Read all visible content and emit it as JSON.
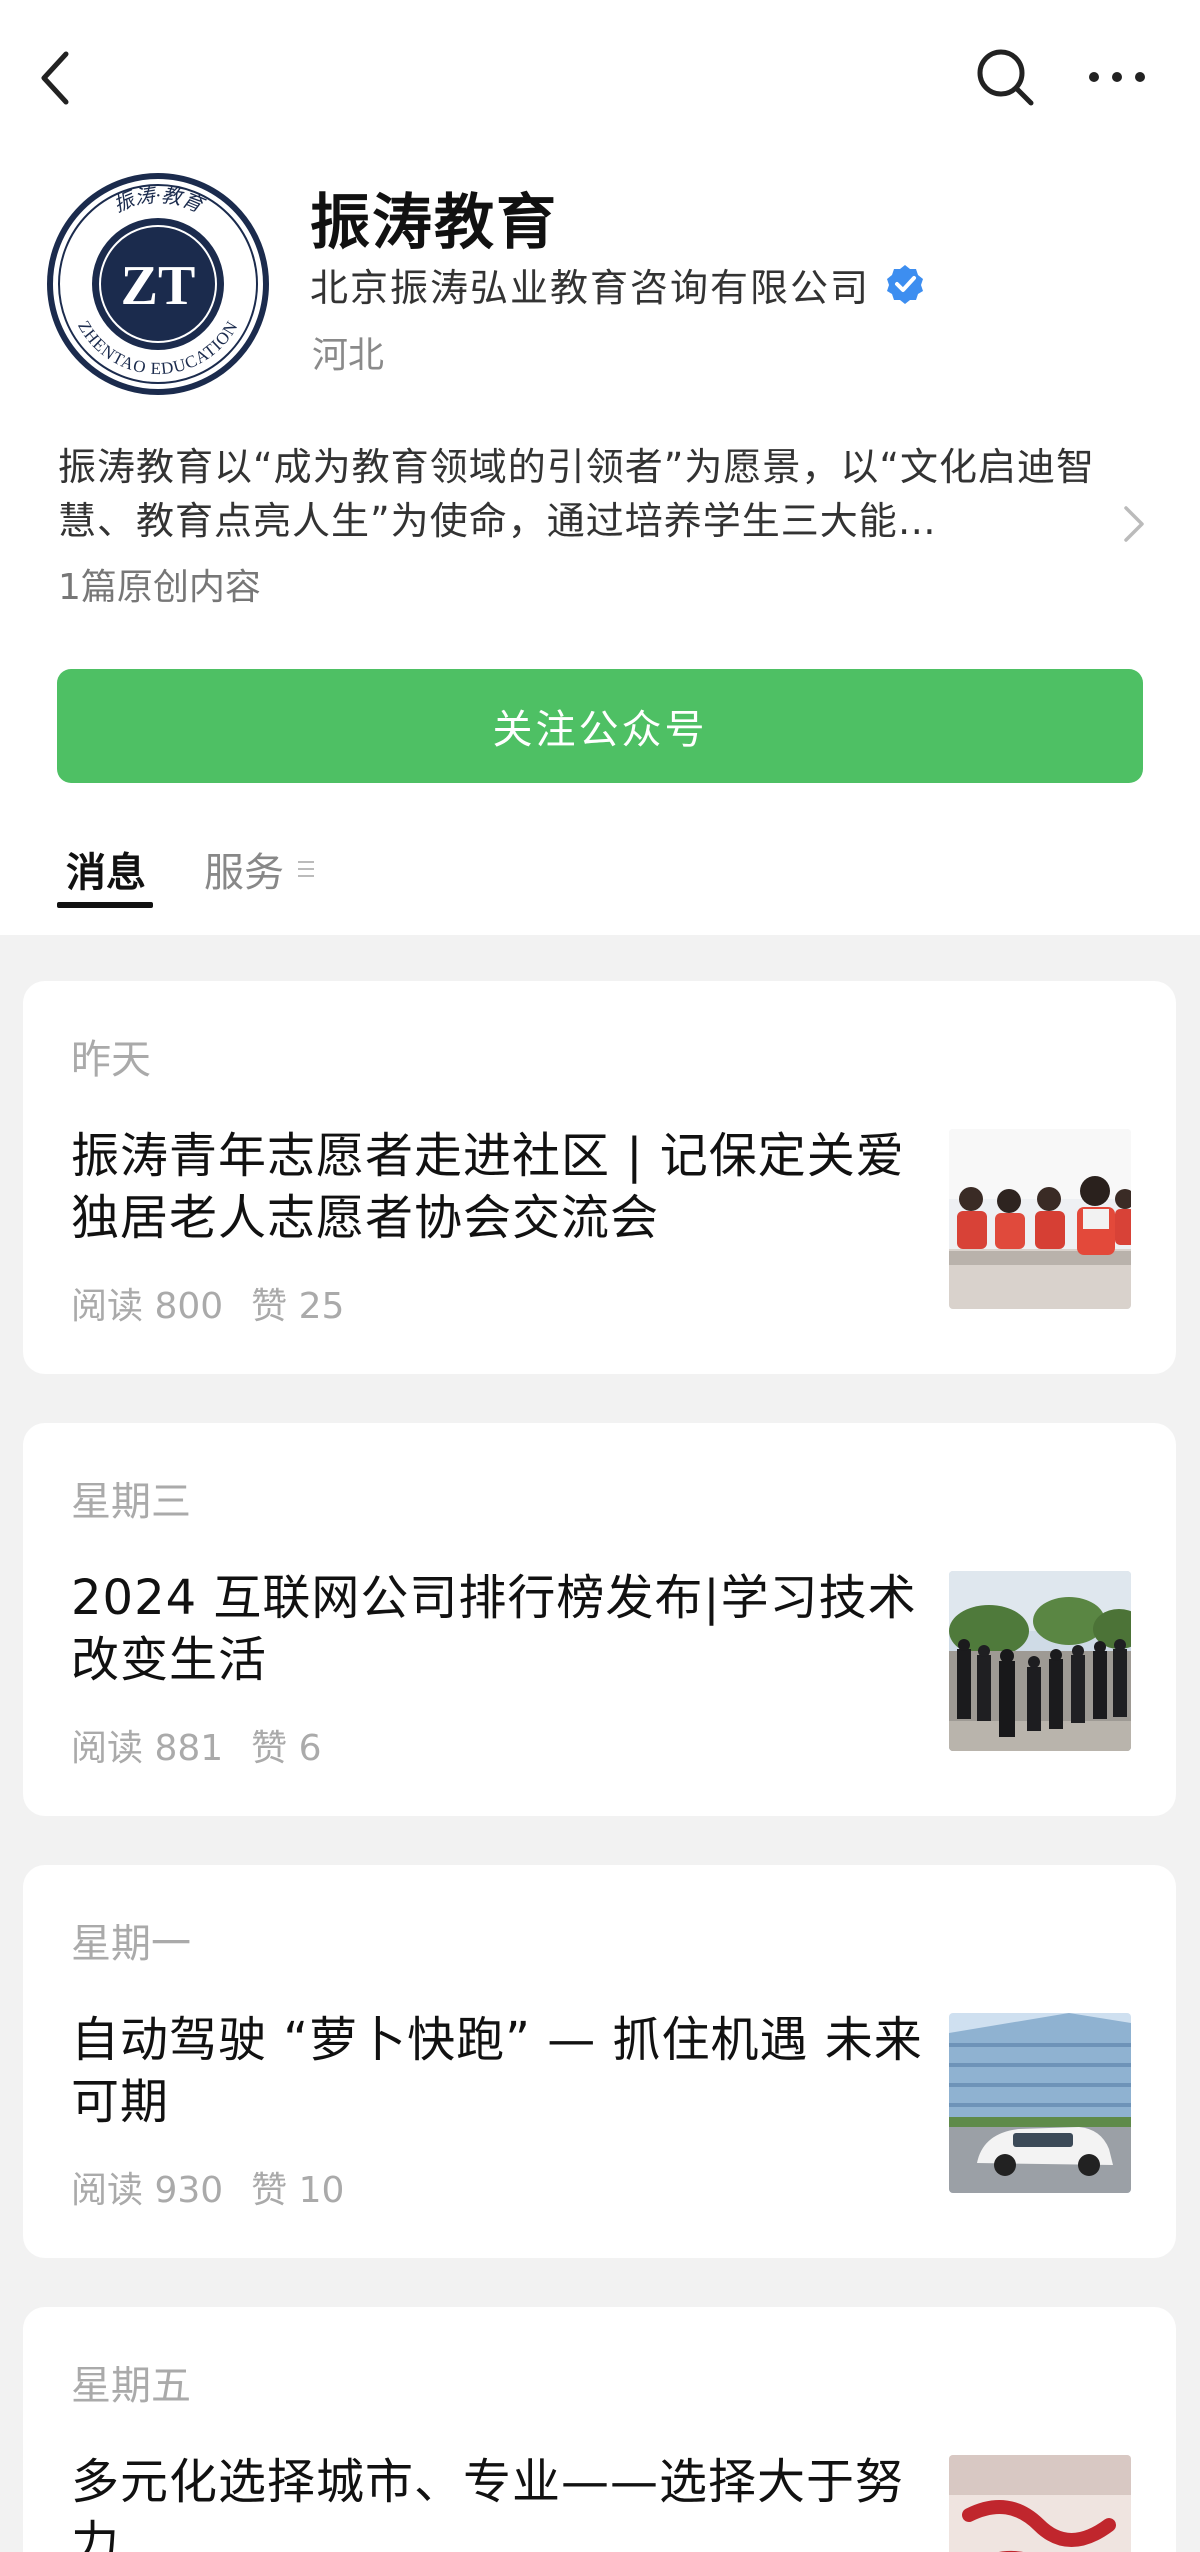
{
  "account": {
    "name": "振涛教育",
    "company": "北京振涛弘业教育咨询有限公司",
    "region": "河北",
    "bio": "振涛教育以“成为教育领域的引领者”为愿景，以“文化启迪智慧、教育点亮人生”为使命，通过培养学生三大能…",
    "originals": "1篇原创内容",
    "follow_label": "关注公众号",
    "logo": {
      "top_text": "振涛·教育",
      "ring_text": "ZHENTAO EDUCATION",
      "mark": "ZT"
    },
    "verified_color": "#3d8ef0"
  },
  "tabs": {
    "messages": "消息",
    "services": "服务"
  },
  "colors": {
    "accent": "#4ec064",
    "brand_navy": "#1b2b4d"
  },
  "articles": [
    {
      "date": "昨天",
      "title": "振涛青年志愿者走进社区 | 记保定关爱独居老人志愿者协会交流会",
      "reads": "阅读 800",
      "likes": "赞 25",
      "thumb": "volunteers-classroom"
    },
    {
      "date": "星期三",
      "title": "2024 互联网公司排行榜发布|学习技术改变生活",
      "reads": "阅读 881",
      "likes": "赞 6",
      "thumb": "students-lineup"
    },
    {
      "date": "星期一",
      "title": "自动驾驶 “萝卜快跑” — 抓住机遇 未来可期",
      "reads": "阅读 930",
      "likes": "赞 10",
      "thumb": "autonomous-car"
    },
    {
      "date": "星期五",
      "title": "多元化选择城市、专业——选择大于努力",
      "reads": "",
      "likes": "",
      "thumb": "red-sign"
    }
  ]
}
